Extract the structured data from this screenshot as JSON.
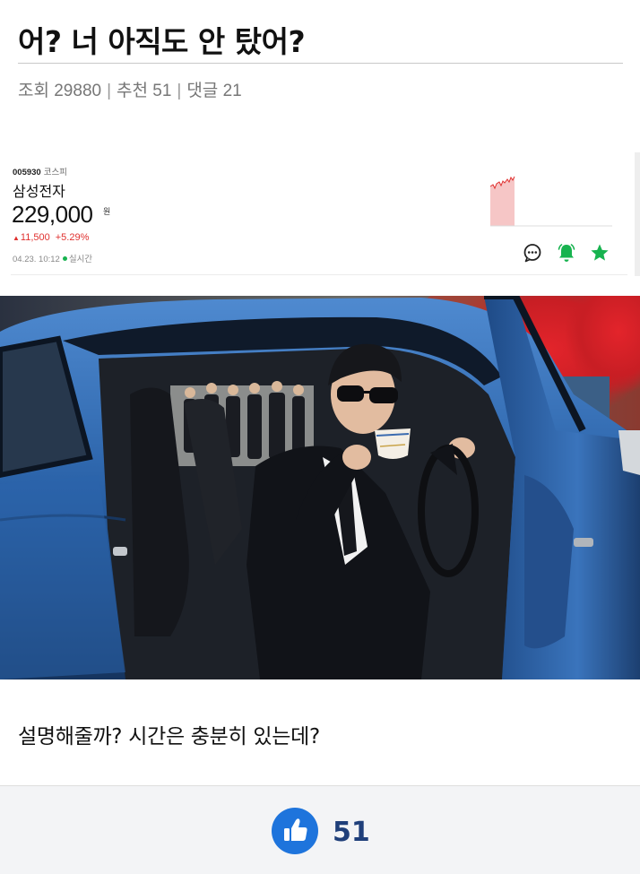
{
  "post": {
    "title": "어? 너 아직도 안 탔어?",
    "meta": {
      "views_label": "조회 29880",
      "recommend_label": "추천 51",
      "comments_label": "댓글 21",
      "separator": "|"
    },
    "caption": "설명해줄까? 시간은 충분히 있는데?"
  },
  "stock_widget": {
    "code": "005930",
    "market": "코스피",
    "name": "삼성전자",
    "price": "229,000",
    "unit": "원",
    "change_arrow": "▲",
    "change_amount": "11,500",
    "change_percent": "+5.29%",
    "timestamp": "04.23. 10:12",
    "status": "실시간",
    "colors": {
      "up": "#e0312f",
      "live": "#17b34f",
      "icon_green": "#17b34f",
      "spark_fill": "#f6c6c6"
    },
    "icons": [
      "chat-icon",
      "alarm-bell-icon",
      "star-icon"
    ]
  },
  "image": {
    "icon": "photo-car-man-drinking-tea"
  },
  "vote": {
    "icon": "thumbs-up-icon",
    "count": "51",
    "color": "#1e74dc"
  }
}
